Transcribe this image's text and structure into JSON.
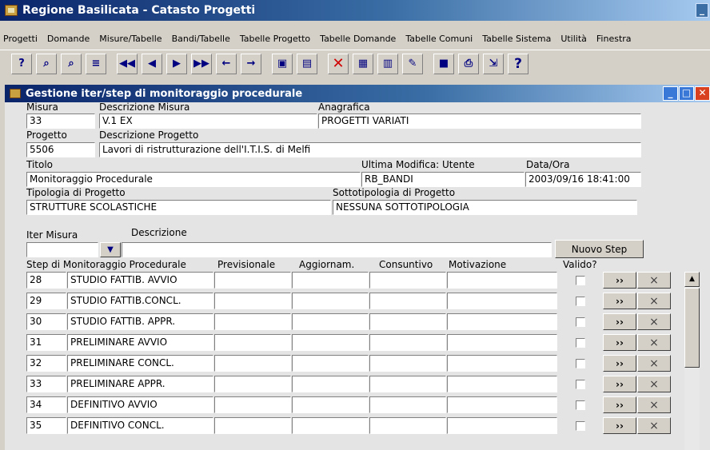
{
  "app": {
    "title": "Regione Basilicata - Catasto Progetti",
    "minimize": "_"
  },
  "menu": [
    "Progetti",
    "Domande",
    "Misure/Tabelle",
    "Bandi/Tabelle",
    "Tabelle Progetto",
    "Tabelle Domande",
    "Tabelle Comuni",
    "Tabelle Sistema",
    "Utilità",
    "Finestra"
  ],
  "toolbar": {
    "icons": [
      "query-find-icon",
      "find-icon",
      "find-next-icon",
      "sort-icon",
      "first-record-icon",
      "prev-record-icon",
      "next-record-icon",
      "last-record-icon",
      "back-icon",
      "forward-icon",
      "new-record-icon",
      "duplicate-icon",
      "delete-icon",
      "clear-icon",
      "copy-icon",
      "edit-icon",
      "save-icon",
      "print-icon",
      "exit-icon",
      "help-icon"
    ],
    "glyphs": [
      "?",
      "⌕",
      "⌕",
      "≡",
      "◀◀",
      "◀",
      "▶",
      "▶▶",
      "←",
      "→",
      "▣",
      "▤",
      "✕",
      "▦",
      "▥",
      "✎",
      "■",
      "⎙",
      "⇲",
      "?"
    ]
  },
  "window": {
    "title": "Gestione iter/step di monitoraggio procedurale"
  },
  "form": {
    "misura": {
      "label": "Misura",
      "value": "33"
    },
    "descrizione_misura": {
      "label": "Descrizione Misura",
      "value": "V.1 EX"
    },
    "anagrafica": {
      "label": "Anagrafica",
      "value": "PROGETTI VARIATI"
    },
    "progetto": {
      "label": "Progetto",
      "value": "5506"
    },
    "descrizione_progetto": {
      "label": "Descrizione Progetto",
      "value": "Lavori di ristrutturazione dell'I.T.I.S. di Melfi"
    },
    "titolo": {
      "label": "Titolo",
      "value": "Monitoraggio Procedurale"
    },
    "ultima_modifica": {
      "label": "Ultima Modifica: Utente",
      "value": "RB_BANDI"
    },
    "data_ora": {
      "label": "Data/Ora",
      "value": "2003/09/16 18:41:00"
    },
    "tipologia": {
      "label": "Tipologia di Progetto",
      "value": "STRUTTURE SCOLASTICHE"
    },
    "sottotipologia": {
      "label": "Sottotipologia di Progetto",
      "value": "NESSUNA SOTTOTIPOLOGIA"
    },
    "iter_misura": {
      "label": "Iter Misura",
      "value": ""
    },
    "descrizione": {
      "label": "Descrizione",
      "value": ""
    },
    "nuovo_step": "Nuovo Step"
  },
  "grid": {
    "headers": {
      "step": "Step di Monitoraggio Procedurale",
      "previsionale": "Previsionale",
      "aggiornam": "Aggiornam.",
      "consuntivo": "Consuntivo",
      "motivazione": "Motivazione",
      "valido": "Valido?"
    },
    "go_label": "››",
    "delete_label": "×",
    "rows": [
      {
        "num": "28",
        "step": "STUDIO FATTIB. AVVIO",
        "previsionale": "",
        "aggiornam": "",
        "consuntivo": "",
        "motivazione": ""
      },
      {
        "num": "29",
        "step": "STUDIO FATTIB.CONCL.",
        "previsionale": "",
        "aggiornam": "",
        "consuntivo": "",
        "motivazione": ""
      },
      {
        "num": "30",
        "step": "STUDIO FATTIB. APPR.",
        "previsionale": "",
        "aggiornam": "",
        "consuntivo": "",
        "motivazione": ""
      },
      {
        "num": "31",
        "step": "PRELIMINARE AVVIO",
        "previsionale": "",
        "aggiornam": "",
        "consuntivo": "",
        "motivazione": ""
      },
      {
        "num": "32",
        "step": "PRELIMINARE CONCL.",
        "previsionale": "",
        "aggiornam": "",
        "consuntivo": "",
        "motivazione": ""
      },
      {
        "num": "33",
        "step": "PRELIMINARE APPR.",
        "previsionale": "",
        "aggiornam": "",
        "consuntivo": "",
        "motivazione": ""
      },
      {
        "num": "34",
        "step": "DEFINITIVO AVVIO",
        "previsionale": "",
        "aggiornam": "",
        "consuntivo": "",
        "motivazione": ""
      },
      {
        "num": "35",
        "step": "DEFINITIVO CONCL.",
        "previsionale": "",
        "aggiornam": "",
        "consuntivo": "",
        "motivazione": ""
      }
    ]
  },
  "colors": {
    "title_bar": "#0a246a",
    "form_bg": "#e4e4e4",
    "face": "#d4d0c8"
  }
}
